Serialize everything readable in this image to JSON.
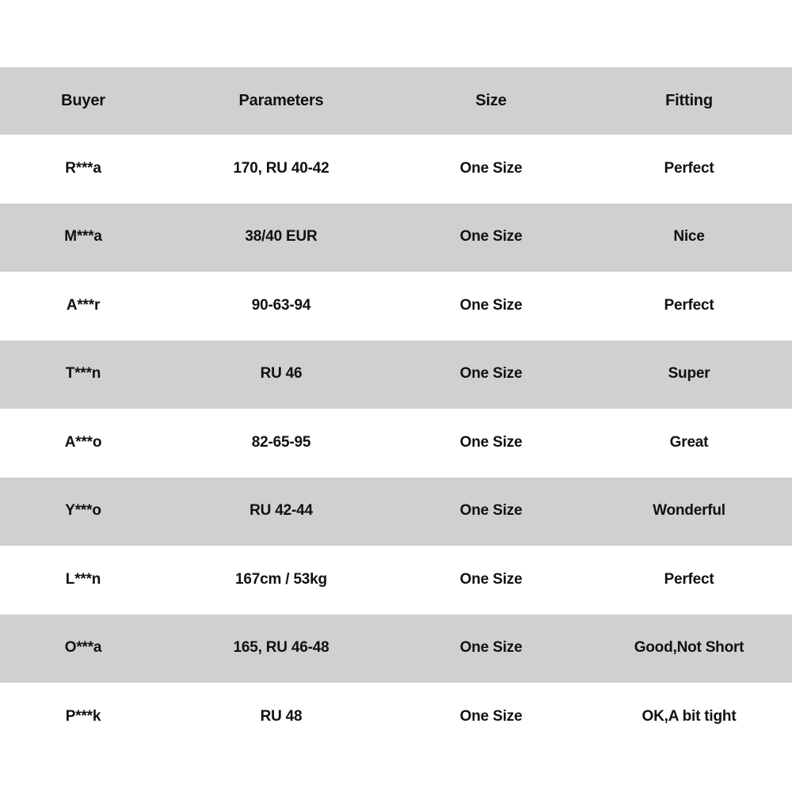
{
  "table": {
    "columns": [
      {
        "key": "buyer",
        "label": "Buyer"
      },
      {
        "key": "params",
        "label": "Parameters"
      },
      {
        "key": "size",
        "label": "Size"
      },
      {
        "key": "fitting",
        "label": "Fitting"
      }
    ],
    "rows": [
      {
        "buyer": "R***a",
        "params": "170, RU 40-42",
        "size": "One Size",
        "fitting": "Perfect"
      },
      {
        "buyer": "M***a",
        "params": "38/40 EUR",
        "size": "One Size",
        "fitting": "Nice"
      },
      {
        "buyer": "A***r",
        "params": "90-63-94",
        "size": "One Size",
        "fitting": "Perfect"
      },
      {
        "buyer": "T***n",
        "params": "RU 46",
        "size": "One Size",
        "fitting": "Super"
      },
      {
        "buyer": "A***o",
        "params": "82-65-95",
        "size": "One Size",
        "fitting": "Great"
      },
      {
        "buyer": "Y***o",
        "params": "RU 42-44",
        "size": "One Size",
        "fitting": "Wonderful"
      },
      {
        "buyer": "L***n",
        "params": "167cm / 53kg",
        "size": "One Size",
        "fitting": "Perfect"
      },
      {
        "buyer": "O***a",
        "params": "165, RU 46-48",
        "size": "One Size",
        "fitting": "Good,Not Short"
      },
      {
        "buyer": "P***k",
        "params": "RU 48",
        "size": "One Size",
        "fitting": "OK,A bit tight"
      }
    ]
  },
  "colors": {
    "row_shaded": "#d1cfd0",
    "row_plain": "#ffffff",
    "text": "#111111",
    "page_background": "#ffffff"
  }
}
